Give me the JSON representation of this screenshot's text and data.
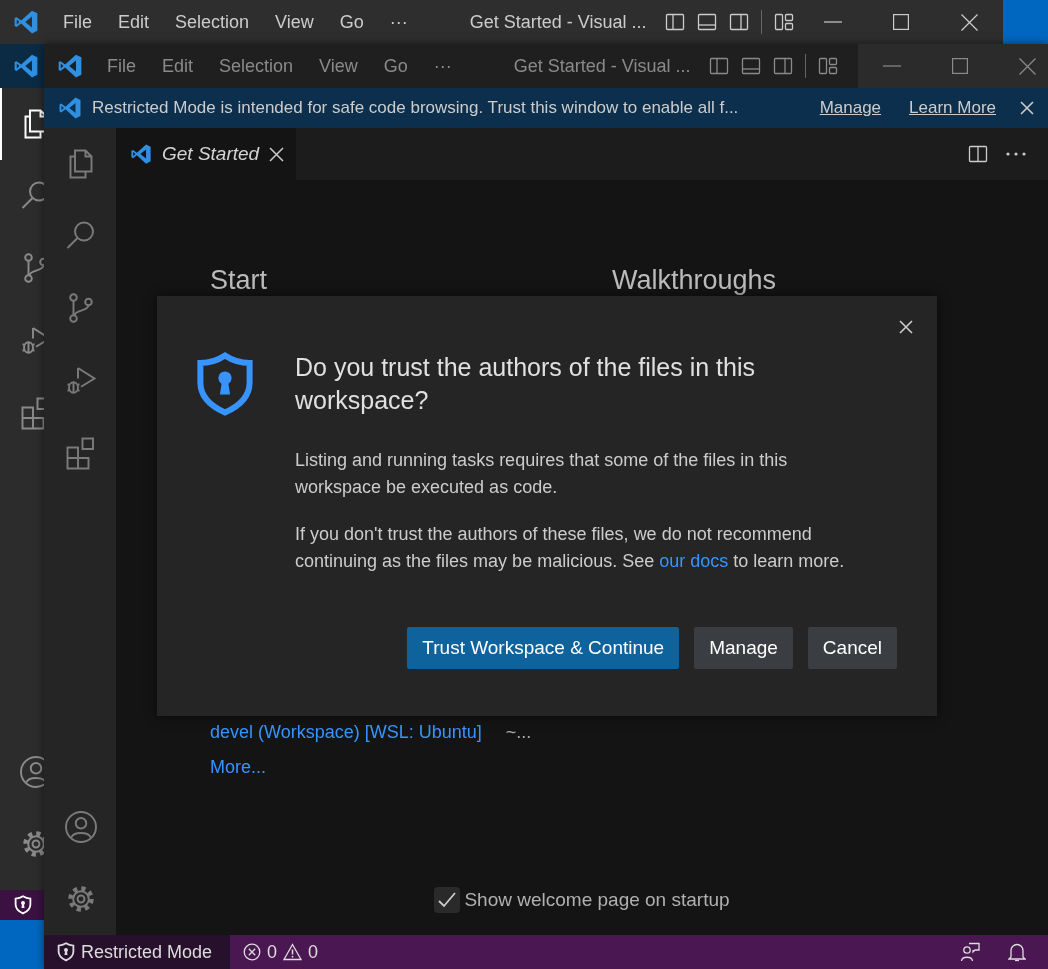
{
  "background_window": {
    "menu": [
      "File",
      "Edit",
      "Selection",
      "View",
      "Go",
      "···"
    ],
    "title": "Get Started - Visual ...",
    "activity_bar": [
      {
        "kind": "explorer",
        "selected": true
      },
      {
        "kind": "search",
        "selected": false
      },
      {
        "kind": "source-control",
        "selected": false
      },
      {
        "kind": "run-debug",
        "selected": false
      },
      {
        "kind": "extensions",
        "selected": false
      }
    ],
    "activity_bottom": [
      {
        "kind": "account"
      },
      {
        "kind": "settings"
      }
    ]
  },
  "window": {
    "menu": [
      "File",
      "Edit",
      "Selection",
      "View",
      "Go",
      "···"
    ],
    "title": "Get Started - Visual ..."
  },
  "banner": {
    "message": "Restricted Mode is intended for safe code browsing. Trust this window to enable all f...",
    "links": [
      "Manage",
      "Learn More"
    ]
  },
  "activity_bar": [
    {
      "kind": "explorer",
      "selected": false
    },
    {
      "kind": "search",
      "selected": false
    },
    {
      "kind": "source-control",
      "selected": false
    },
    {
      "kind": "run-debug",
      "selected": false
    },
    {
      "kind": "extensions",
      "selected": false
    }
  ],
  "activity_bottom": [
    {
      "kind": "account"
    },
    {
      "kind": "settings"
    }
  ],
  "tabs": [
    {
      "label": "Get Started",
      "selected": true
    }
  ],
  "welcome": {
    "start_heading": "Start",
    "walkthroughs_heading": "Walkthroughs",
    "recent": [
      {
        "name": "devel (Workspace) [WSL: Ubuntu]",
        "path": "~..."
      }
    ],
    "more": "More...",
    "show_on_startup": {
      "label": "Show welcome page on startup",
      "checked": true
    }
  },
  "dialog": {
    "title": "Do you trust the authors of the files in this workspace?",
    "paragraphs": [
      {
        "text": "Listing and running tasks requires that some of the files in this workspace be executed as code."
      },
      {
        "text": "If you don't trust the authors of these files, we do not recommend continuing as the files may be malicious. See ",
        "link": "our docs",
        "after": " to learn more."
      }
    ],
    "buttons": [
      {
        "label": "Trust Workspace & Continue",
        "primary": true
      },
      {
        "label": "Manage",
        "primary": false
      },
      {
        "label": "Cancel",
        "primary": false
      }
    ]
  },
  "status_bar": {
    "mode": "Restricted Mode",
    "errors": "0",
    "warnings": "0"
  }
}
